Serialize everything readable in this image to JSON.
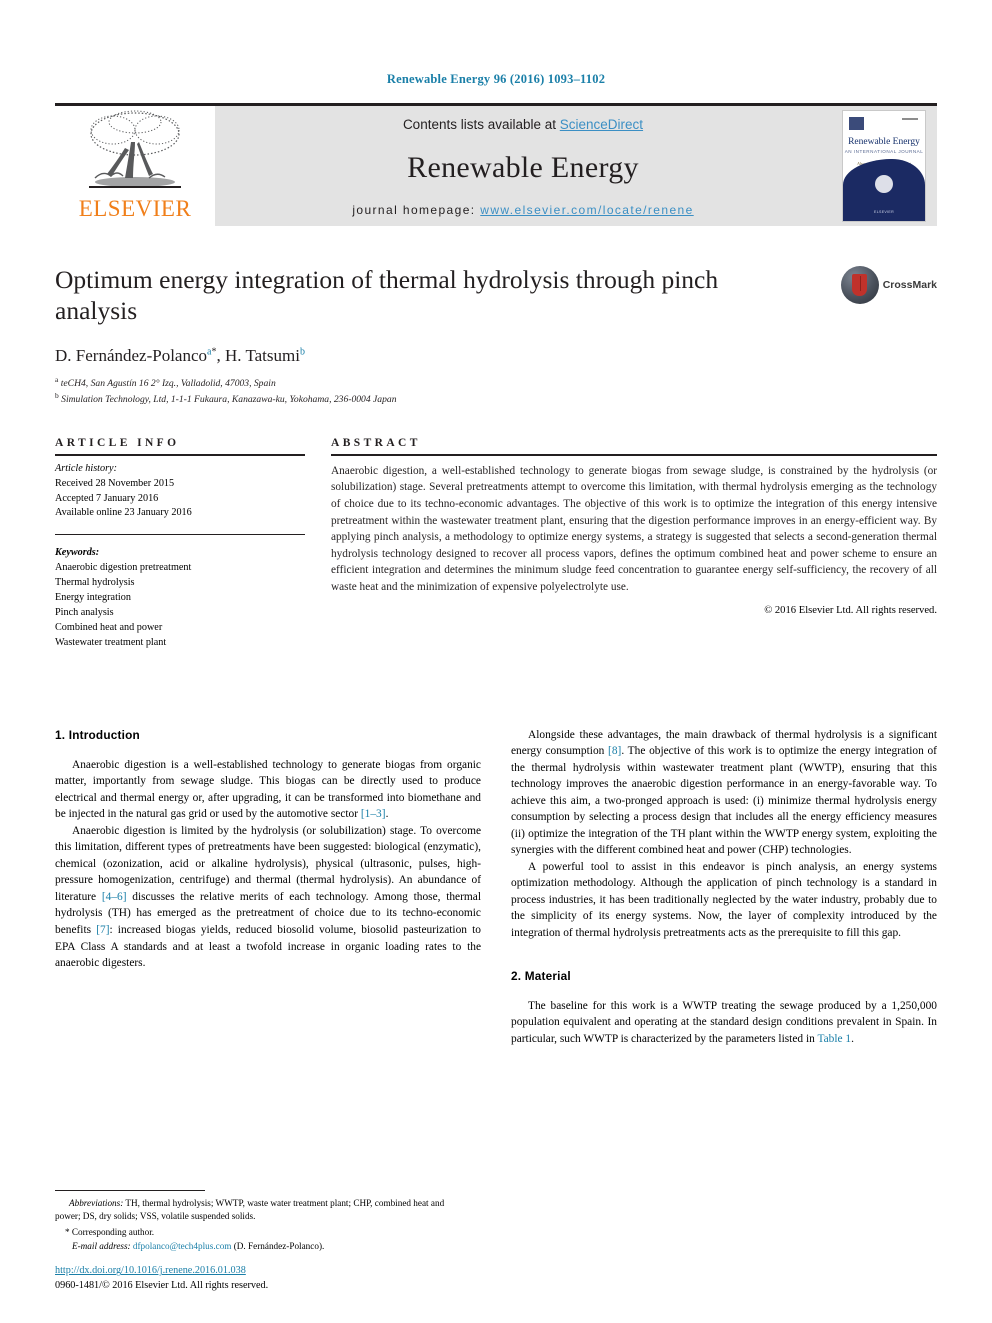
{
  "running_head": "Renewable Energy 96 (2016) 1093–1102",
  "masthead": {
    "publisher": "ELSEVIER",
    "contents_prefix": "Contents lists available at ",
    "contents_link": "ScienceDirect",
    "journal_name": "Renewable Energy",
    "homepage_prefix": "journal homepage: ",
    "homepage_url": "www.elsevier.com/locate/renene",
    "cover": {
      "title": "Renewable Energy",
      "subtitle": "AN INTERNATIONAL JOURNAL",
      "subtitle2": "Also available on ScienceDirect",
      "footer": "ELSEVIER"
    }
  },
  "article": {
    "title": "Optimum energy integration of thermal hydrolysis through pinch analysis",
    "authors_plain": "D. Fernández-Polanco, H. Tatsumi",
    "author1": "D. Fernández-Polanco",
    "author1_sup": "a",
    "author1_star": "*",
    "author2": "H. Tatsumi",
    "author2_sup": "b",
    "affiliation_a_sup": "a",
    "affiliation_a": "teCH4, San Agustín 16 2° Izq., Valladolid, 47003, Spain",
    "affiliation_b_sup": "b",
    "affiliation_b": "Simulation Technology, Ltd, 1-1-1 Fukaura, Kanazawa-ku, Yokohama, 236-0004 Japan",
    "crossmark_label": "CrossMark"
  },
  "article_info": {
    "heading": "ARTICLE INFO",
    "history_label": "Article history:",
    "history": [
      "Received 28 November 2015",
      "Accepted 7 January 2016",
      "Available online 23 January 2016"
    ],
    "keywords_label": "Keywords:",
    "keywords": [
      "Anaerobic digestion pretreatment",
      "Thermal hydrolysis",
      "Energy integration",
      "Pinch analysis",
      "Combined heat and power",
      "Wastewater treatment plant"
    ]
  },
  "abstract": {
    "heading": "ABSTRACT",
    "text": "Anaerobic digestion, a well-established technology to generate biogas from sewage sludge, is constrained by the hydrolysis (or solubilization) stage. Several pretreatments attempt to overcome this limitation, with thermal hydrolysis emerging as the technology of choice due to its techno-economic advantages. The objective of this work is to optimize the integration of this energy intensive pretreatment within the wastewater treatment plant, ensuring that the digestion performance improves in an energy-efficient way. By applying pinch analysis, a methodology to optimize energy systems, a strategy is suggested that selects a second-generation thermal hydrolysis technology designed to recover all process vapors, defines the optimum combined heat and power scheme to ensure an efficient integration and determines the minimum sludge feed concentration to guarantee energy self-sufficiency, the recovery of all waste heat and the minimization of expensive polyelectrolyte use.",
    "copyright": "© 2016 Elsevier Ltd. All rights reserved."
  },
  "sections": {
    "intro_heading": "1. Introduction",
    "intro_p1_a": "Anaerobic digestion is a well-established technology to generate biogas from organic matter, importantly from sewage sludge. This biogas can be directly used to produce electrical and thermal energy or, after upgrading, it can be transformed into biomethane and be injected in the natural gas grid or used by the automotive sector ",
    "intro_p1_ref": "[1–3]",
    "intro_p1_b": ".",
    "intro_p2_a": "Anaerobic digestion is limited by the hydrolysis (or solubilization) stage. To overcome this limitation, different types of pretreatments have been suggested: biological (enzymatic), chemical (ozonization, acid or alkaline hydrolysis), physical (ultrasonic, pulses, high-pressure homogenization, centrifuge) and thermal (thermal hydrolysis). An abundance of literature ",
    "intro_p2_ref1": "[4–6]",
    "intro_p2_b": " discusses the relative merits of each technology. Among those, thermal hydrolysis (TH) has emerged as the pretreatment of choice due to its techno-economic benefits ",
    "intro_p2_ref2": "[7]",
    "intro_p2_c": ": increased biogas yields, reduced biosolid volume, biosolid pasteurization to EPA Class A standards and at least a twofold increase in organic loading rates to the anaerobic digesters.",
    "right_p1_a": "Alongside these advantages, the main drawback of thermal hydrolysis is a significant energy consumption ",
    "right_p1_ref": "[8]",
    "right_p1_b": ". The objective of this work is to optimize the energy integration of the thermal hydrolysis within wastewater treatment plant (WWTP), ensuring that this technology improves the anaerobic digestion performance in an energy-favorable way. To achieve this aim, a two-pronged approach is used: (i) minimize thermal hydrolysis energy consumption by selecting a process design that includes all the energy efficiency measures (ii) optimize the integration of the TH plant within the WWTP energy system, exploiting the synergies with the different combined heat and power (CHP) technologies.",
    "right_p2": "A powerful tool to assist in this endeavor is pinch analysis, an energy systems optimization methodology. Although the application of pinch technology is a standard in process industries, it has been traditionally neglected by the water industry, probably due to the simplicity of its energy systems. Now, the layer of complexity introduced by the integration of thermal hydrolysis pretreatments acts as the prerequisite to fill this gap.",
    "material_heading": "2. Material",
    "material_p1_a": "The baseline for this work is a WWTP treating the sewage produced by a 1,250,000 population equivalent and operating at the standard design conditions prevalent in Spain. In particular, such WWTP is characterized by the parameters listed in ",
    "material_p1_ref": "Table 1",
    "material_p1_b": "."
  },
  "footnotes": {
    "abbrev_label": "Abbreviations:",
    "abbrev_text": " TH, thermal hydrolysis; WWTP, waste water treatment plant; CHP, combined heat and power; DS, dry solids; VSS, volatile suspended solids.",
    "corresponding": "* Corresponding author.",
    "email_label": "E-mail address:",
    "email": "dfpolanco@tech4plus.com",
    "email_suffix": " (D. Fernández-Polanco)."
  },
  "footer": {
    "doi": "http://dx.doi.org/10.1016/j.renene.2016.01.038",
    "issn_line": "0960-1481/© 2016 Elsevier Ltd. All rights reserved."
  },
  "colors": {
    "link": "#1a7fa8",
    "orange": "#f07f1a",
    "masthead_bg": "#e3e3e3",
    "cover_navy": "#1b2a63"
  }
}
